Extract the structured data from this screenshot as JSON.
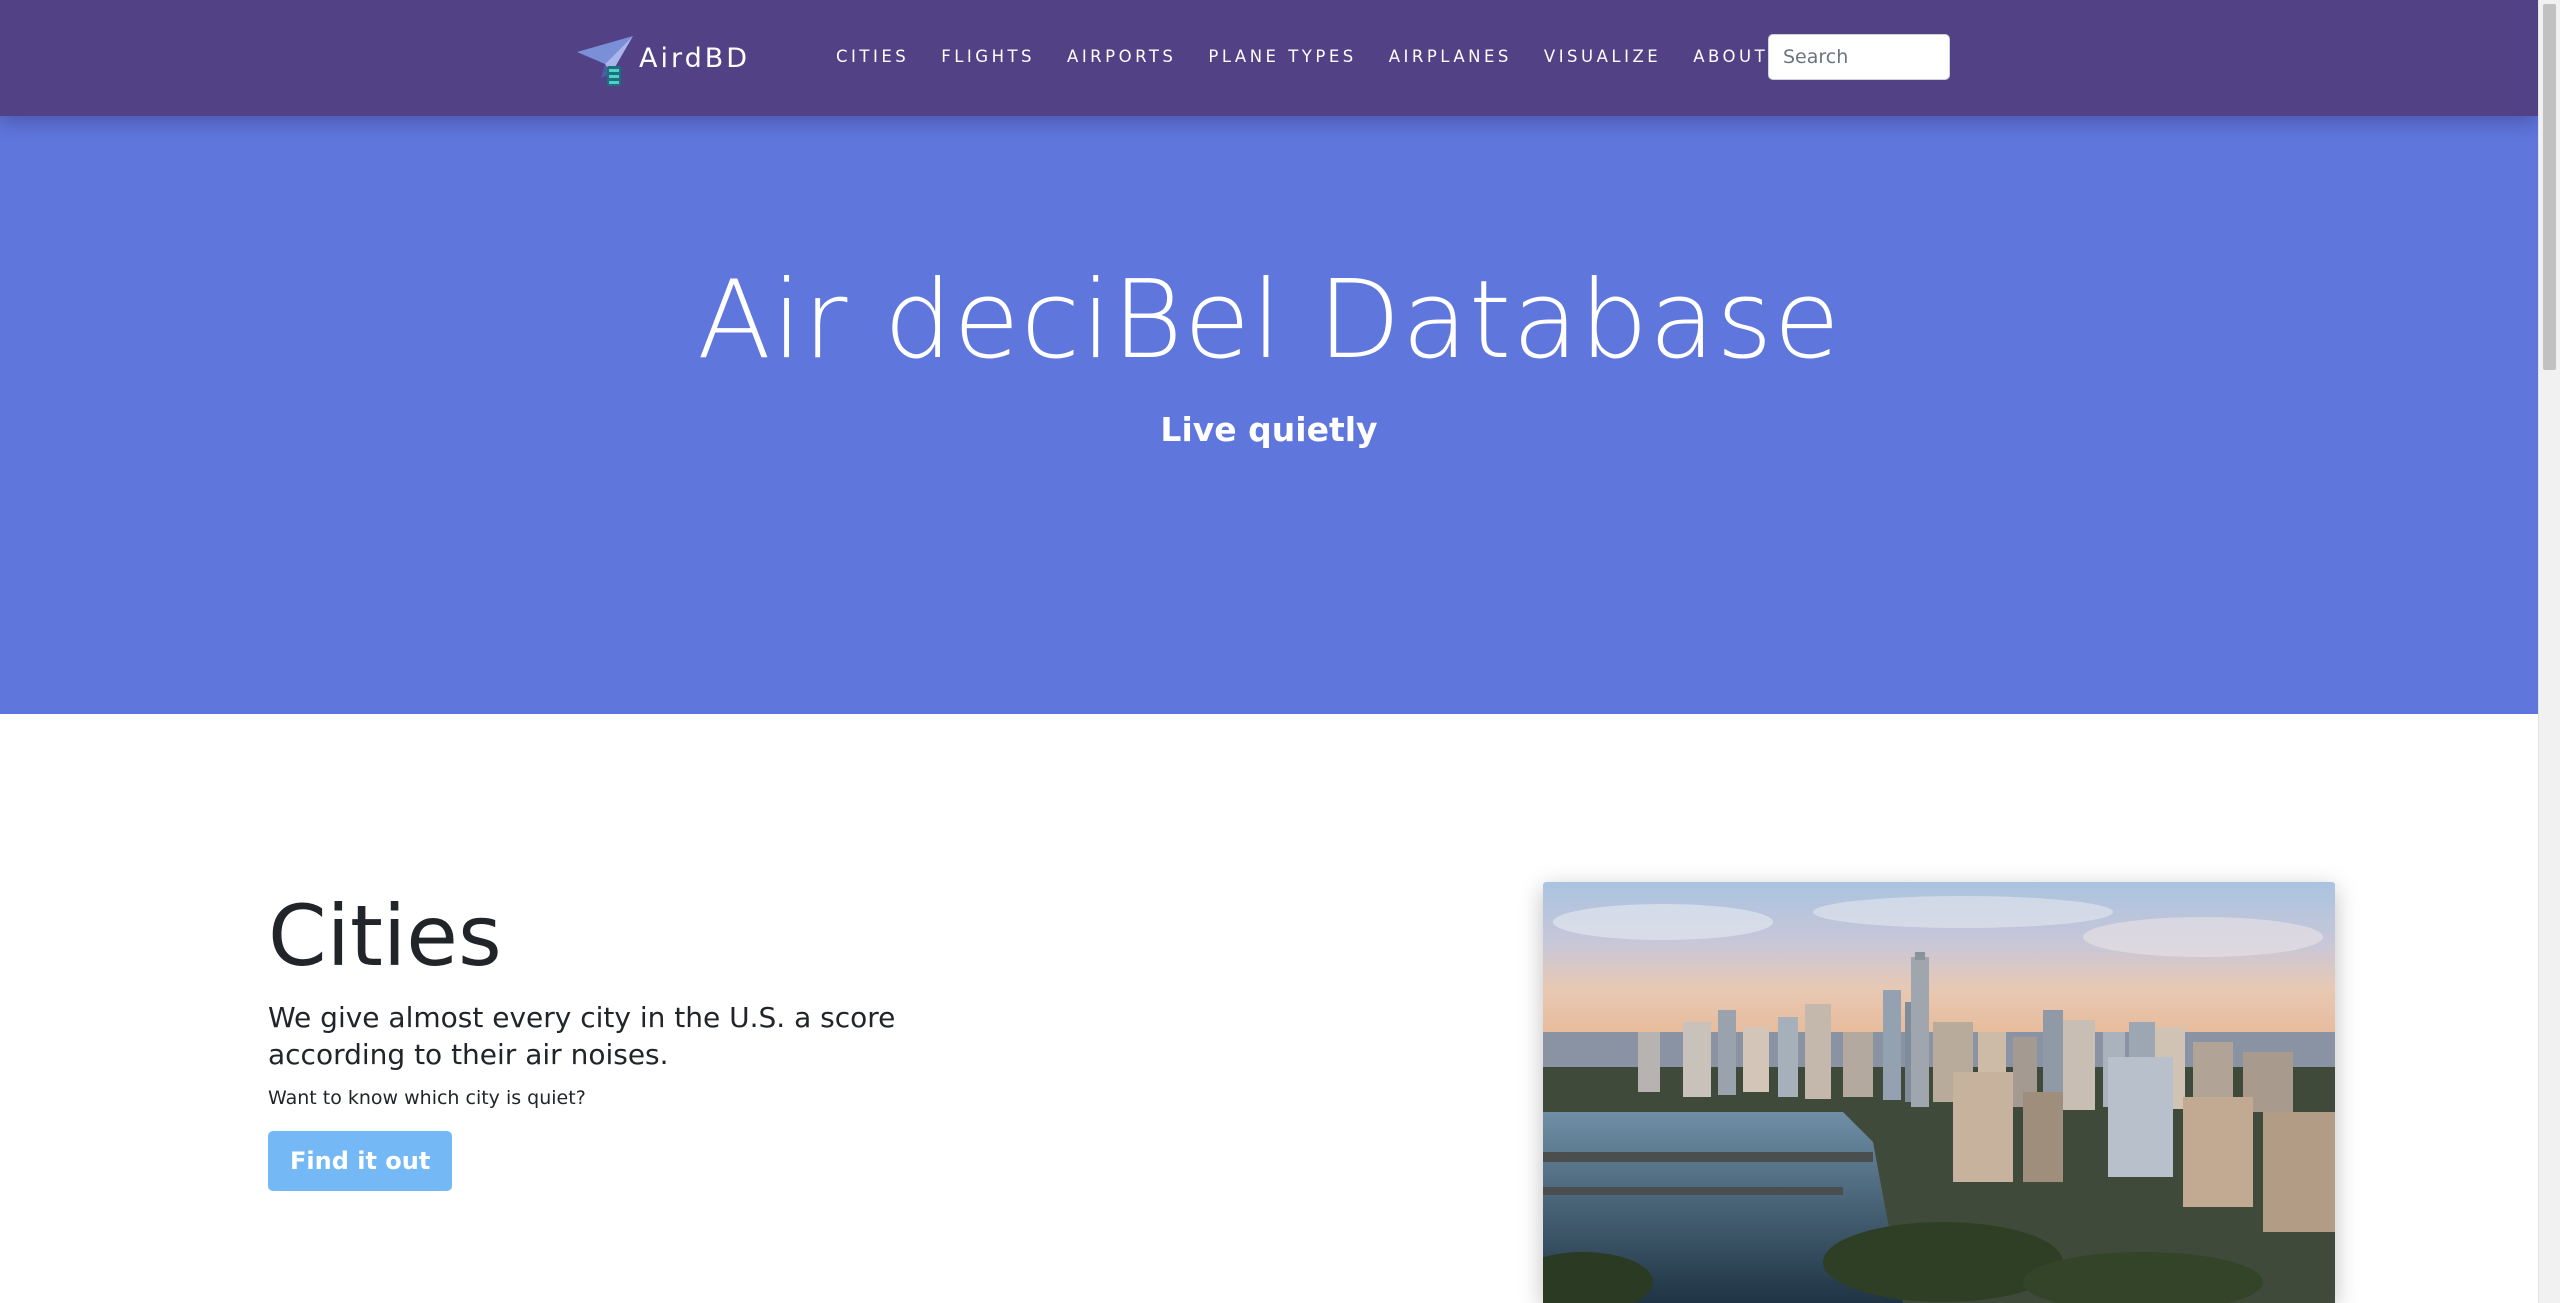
{
  "navbar": {
    "brand": "AirdBD",
    "links": [
      {
        "label": "CITIES"
      },
      {
        "label": "FLIGHTS"
      },
      {
        "label": "AIRPORTS"
      },
      {
        "label": "PLANE TYPES"
      },
      {
        "label": "AIRPLANES"
      },
      {
        "label": "VISUALIZE"
      },
      {
        "label": "ABOUT"
      }
    ],
    "search_placeholder": "Search"
  },
  "hero": {
    "title": "Air deciBel Database",
    "subtitle": "Live quietly"
  },
  "cities": {
    "heading": "Cities",
    "lead": "We give almost every city in the U.S. a score according to their air noises.",
    "question": "Want to know which city is quiet?",
    "button_label": "Find it out"
  },
  "colors": {
    "navbar": "#534185",
    "hero": "#5f76dc",
    "button": "#74b9f5"
  }
}
